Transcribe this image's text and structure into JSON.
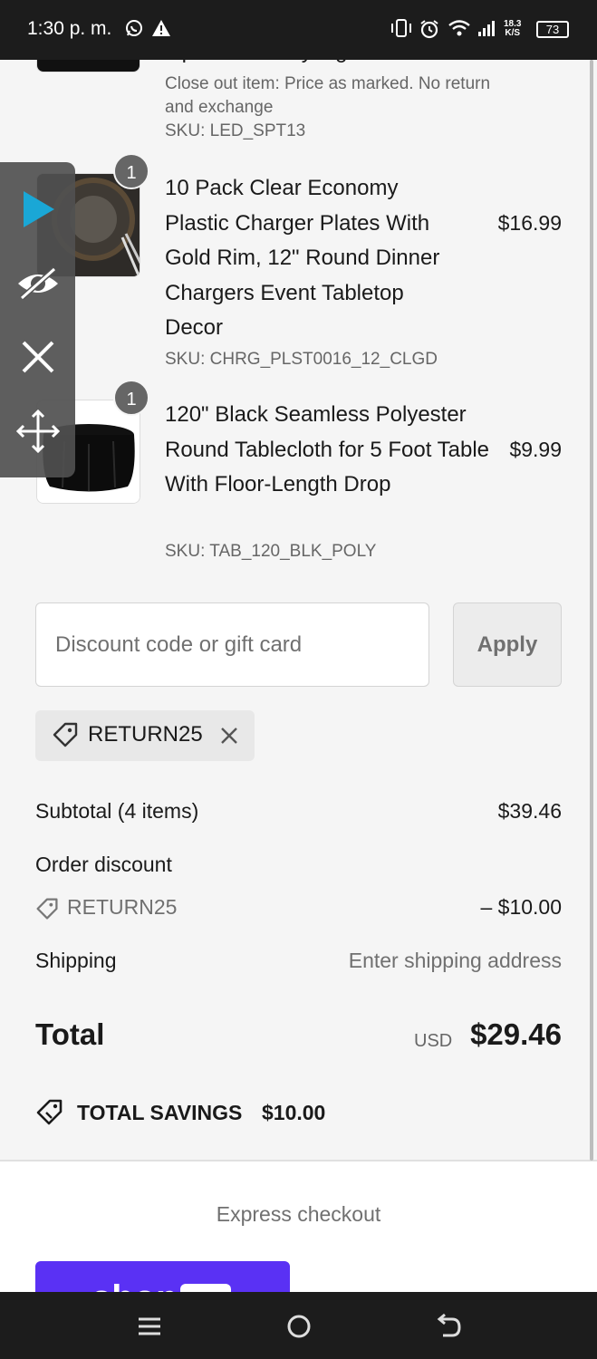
{
  "status_bar": {
    "time": "1:30 p. m.",
    "network_speed_top": "18.3",
    "network_speed_bottom": "K/S",
    "battery": "73"
  },
  "cart": {
    "partial_item": {
      "title_fragment": "Operated Party Light",
      "note": "Close out item: Price as marked. No return and exchange",
      "sku": "SKU: LED_SPT13"
    },
    "items": [
      {
        "quantity": "1",
        "title": "10 Pack Clear Economy Plastic Charger Plates With Gold Rim, 12\" Round Dinner Chargers Event Tabletop Decor",
        "price": "$16.99",
        "sku": "SKU: CHRG_PLST0016_12_CLGD"
      },
      {
        "quantity": "1",
        "title": "120\" Black Seamless Polyester Round Tablecloth for 5 Foot Table With Floor-Length Drop",
        "price": "$9.99",
        "sku": "SKU: TAB_120_BLK_POLY"
      }
    ]
  },
  "discount": {
    "placeholder": "Discount code or gift card",
    "apply_label": "Apply",
    "applied_code": "RETURN25"
  },
  "summary": {
    "subtotal_label": "Subtotal (4 items)",
    "subtotal_value": "$39.46",
    "order_discount_label": "Order discount",
    "discount_code": "RETURN25",
    "discount_value": "– $10.00",
    "shipping_label": "Shipping",
    "shipping_value": "Enter shipping address",
    "total_label": "Total",
    "currency": "USD",
    "total_value": "$29.46",
    "savings_label": "TOTAL SAVINGS",
    "savings_value": "$10.00"
  },
  "express": {
    "title": "Express checkout"
  },
  "colors": {
    "shop_pay": "#5a31f4",
    "accent_play": "#1aa7d6"
  }
}
